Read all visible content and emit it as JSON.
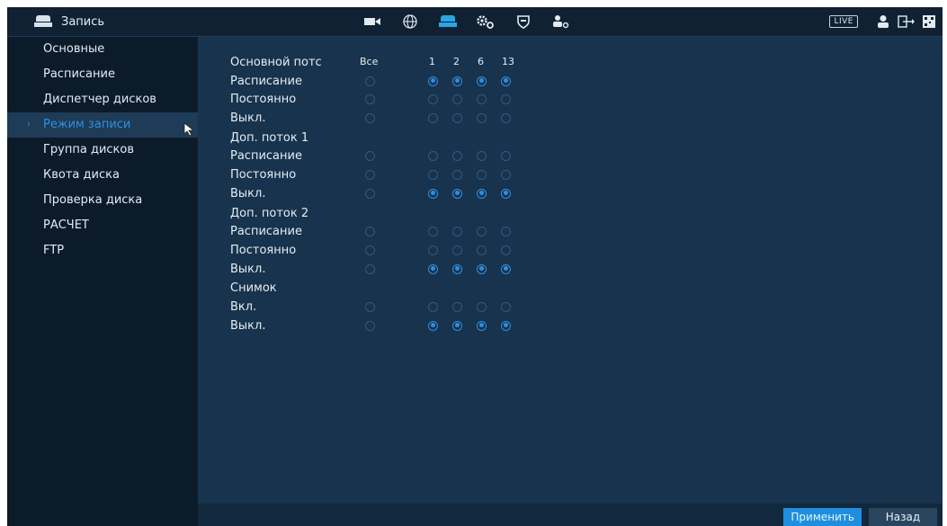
{
  "topbar": {
    "title": "Запись",
    "nav_icons": [
      "camera-icon",
      "network-icon",
      "storage-icon",
      "system-settings-icon",
      "security-icon",
      "account-icon"
    ],
    "active_nav": "storage-icon",
    "live_label": "LIVE"
  },
  "sidebar": {
    "items": [
      {
        "label": "Основные"
      },
      {
        "label": "Расписание"
      },
      {
        "label": "Диспетчер дисков"
      },
      {
        "label": "Режим записи",
        "active": true
      },
      {
        "label": "Группа дисков"
      },
      {
        "label": "Квота диска"
      },
      {
        "label": "Проверка диска"
      },
      {
        "label": "РАСЧЕТ"
      },
      {
        "label": "FTP"
      }
    ]
  },
  "grid": {
    "header": {
      "label": "Основной потс",
      "all": "Все",
      "channels": [
        "1",
        "2",
        "6",
        "13"
      ]
    },
    "sections": [
      {
        "rows": [
          {
            "label": "Расписание",
            "all": false,
            "values": [
              true,
              true,
              true,
              true
            ]
          },
          {
            "label": "Постоянно",
            "all": false,
            "values": [
              false,
              false,
              false,
              false
            ]
          },
          {
            "label": "Выкл.",
            "all": false,
            "values": [
              false,
              false,
              false,
              false
            ]
          }
        ]
      },
      {
        "title": "Доп. поток 1",
        "rows": [
          {
            "label": "Расписание",
            "all": false,
            "values": [
              false,
              false,
              false,
              false
            ]
          },
          {
            "label": "Постоянно",
            "all": false,
            "values": [
              false,
              false,
              false,
              false
            ]
          },
          {
            "label": "Выкл.",
            "all": false,
            "values": [
              true,
              true,
              true,
              true
            ]
          }
        ]
      },
      {
        "title": "Доп. поток 2",
        "rows": [
          {
            "label": "Расписание",
            "all": false,
            "values": [
              false,
              false,
              false,
              false
            ]
          },
          {
            "label": "Постоянно",
            "all": false,
            "values": [
              false,
              false,
              false,
              false
            ]
          },
          {
            "label": "Выкл.",
            "all": false,
            "values": [
              true,
              true,
              true,
              true
            ]
          }
        ]
      },
      {
        "title": "Снимок",
        "rows": [
          {
            "label": "Вкл.",
            "all": false,
            "values": [
              false,
              false,
              false,
              false
            ]
          },
          {
            "label": "Выкл.",
            "all": false,
            "values": [
              true,
              true,
              true,
              true
            ]
          }
        ]
      }
    ]
  },
  "footer": {
    "apply_label": "Применить",
    "back_label": "Назад"
  },
  "colors": {
    "accent": "#2f8fe0",
    "background": "#18334d",
    "sidebar": "#0c1b2a",
    "topbar": "#0f2132"
  }
}
